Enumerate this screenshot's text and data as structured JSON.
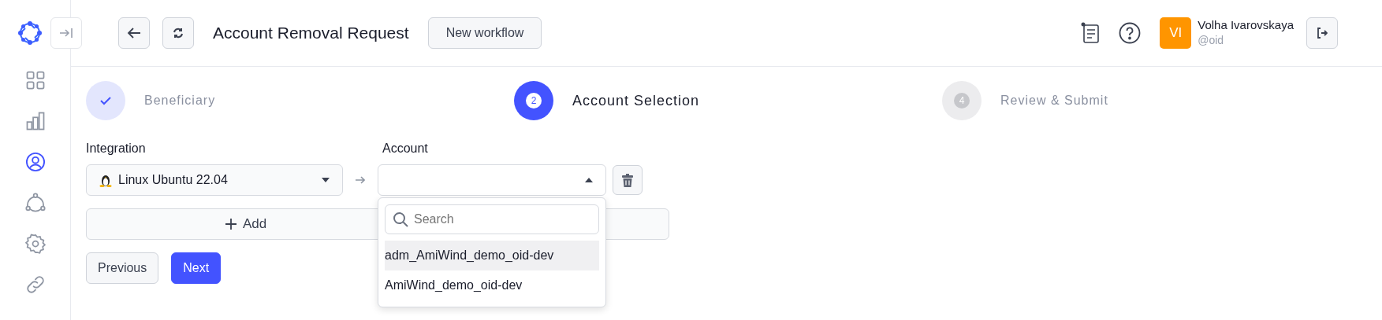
{
  "header": {
    "title": "Account Removal Request",
    "new_button": "New workflow",
    "user": {
      "initials": "VI",
      "name": "Volha Ivarovskaya",
      "handle": "@oid"
    }
  },
  "sidebar": {
    "items": [
      {
        "selected": false
      },
      {
        "selected": false
      },
      {
        "selected": true
      },
      {
        "selected": false
      },
      {
        "selected": false
      },
      {
        "selected": false
      }
    ]
  },
  "steps": [
    {
      "kind": "done",
      "label": "Beneficiary"
    },
    {
      "kind": "current",
      "number": "2",
      "label": "Account Selection"
    },
    {
      "kind": "upcoming",
      "number": "4",
      "label": "Review & Submit"
    }
  ],
  "form": {
    "integration_label": "Integration",
    "integration_value": "Linux Ubuntu 22.04",
    "account_label": "Account",
    "account_expanded": true,
    "add_button": "Add",
    "dropdown": {
      "placeholder": "Search",
      "options": [
        {
          "label": "adm_AmiWind_demo_oid-dev",
          "selected": true
        },
        {
          "label": "AmiWind_demo_oid-dev",
          "selected": false
        }
      ]
    }
  },
  "buttons": {
    "previous": "Previous",
    "next": "Next"
  }
}
